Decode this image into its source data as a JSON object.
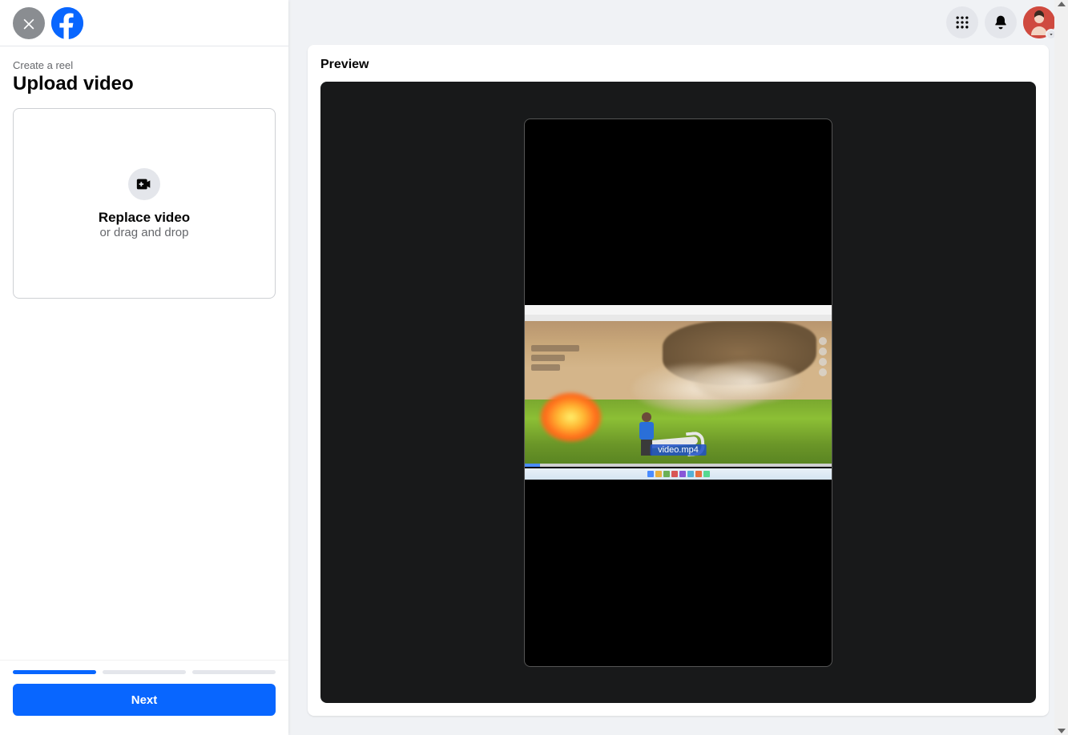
{
  "sidebar": {
    "breadcrumb": "Create a reel",
    "title": "Upload video",
    "upload": {
      "action_label": "Replace video",
      "hint": "or drag and drop"
    },
    "next_button": "Next",
    "progress": {
      "total": 3,
      "current": 1
    }
  },
  "preview": {
    "title": "Preview",
    "filename": "video.mp4"
  },
  "colors": {
    "brand": "#0866ff",
    "bg": "#f0f2f5"
  }
}
